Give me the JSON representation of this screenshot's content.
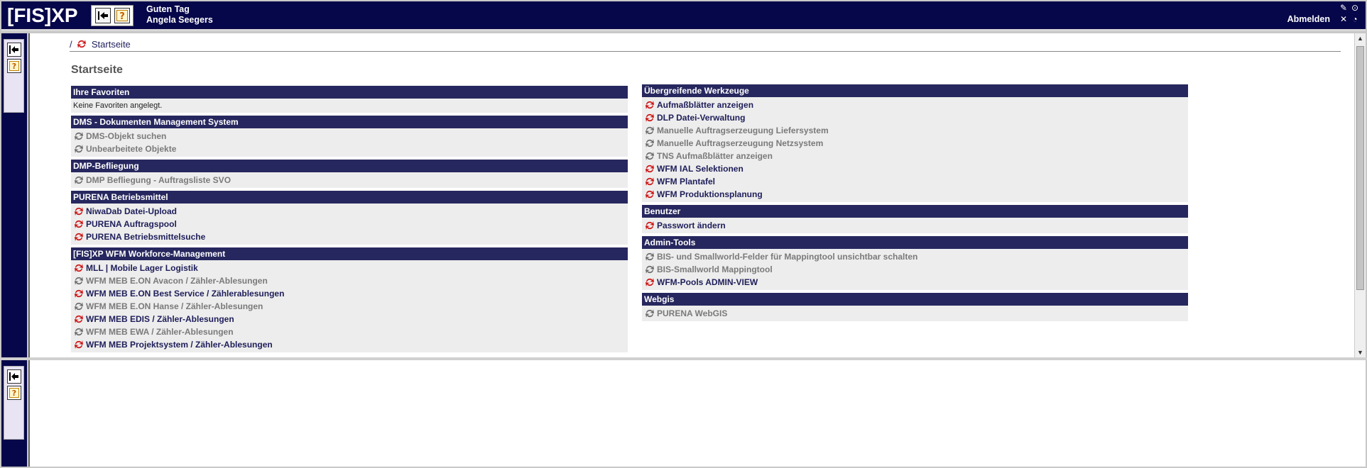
{
  "app": {
    "logo": "[FIS]XP",
    "greeting": "Guten Tag",
    "user": "Angela Seegers",
    "logout": "Abmelden"
  },
  "breadcrumb": {
    "separator": "/",
    "current": "Startseite"
  },
  "page_title": "Startseite",
  "colors": {
    "header_bg": "#06064a",
    "panel_head": "#27275f",
    "active_link": "#1e1e5a",
    "inactive_link": "#7a7a7a",
    "icon_red": "#cc1111"
  },
  "left_column": [
    {
      "title": "Ihre Favoriten",
      "text": "Keine Favoriten angelegt.",
      "items": []
    },
    {
      "title": "DMS - Dokumenten Management System",
      "items": [
        {
          "label": "DMS-Objekt suchen",
          "active": false
        },
        {
          "label": "Unbearbeitete Objekte",
          "active": false
        }
      ]
    },
    {
      "title": "DMP-Befliegung",
      "items": [
        {
          "label": "DMP Befliegung - Auftragsliste SVO",
          "active": false
        }
      ]
    },
    {
      "title": "PURENA Betriebsmittel",
      "items": [
        {
          "label": "NiwaDab Datei-Upload",
          "active": true
        },
        {
          "label": "PURENA Auftragspool",
          "active": true
        },
        {
          "label": "PURENA Betriebsmittelsuche",
          "active": true
        }
      ]
    },
    {
      "title": "[FIS]XP WFM Workforce-Management",
      "items": [
        {
          "label": "MLL | Mobile Lager Logistik",
          "active": true
        },
        {
          "label": "WFM MEB E.ON Avacon / Zähler-Ablesungen",
          "active": false
        },
        {
          "label": "WFM MEB E.ON Best Service / Zählerablesungen",
          "active": true
        },
        {
          "label": "WFM MEB E.ON Hanse / Zähler-Ablesungen",
          "active": false
        },
        {
          "label": "WFM MEB EDIS / Zähler-Ablesungen",
          "active": true
        },
        {
          "label": "WFM MEB EWA / Zähler-Ablesungen",
          "active": false
        },
        {
          "label": "WFM MEB Projektsystem / Zähler-Ablesungen",
          "active": true
        }
      ]
    }
  ],
  "right_column": [
    {
      "title": "Übergreifende Werkzeuge",
      "items": [
        {
          "label": "Aufmaßblätter anzeigen",
          "active": true
        },
        {
          "label": "DLP Datei-Verwaltung",
          "active": true
        },
        {
          "label": "Manuelle Auftragserzeugung Liefersystem",
          "active": false
        },
        {
          "label": "Manuelle Auftragserzeugung Netzsystem",
          "active": false
        },
        {
          "label": "TNS Aufmaßblätter anzeigen",
          "active": false
        },
        {
          "label": "WFM IAL Selektionen",
          "active": true
        },
        {
          "label": "WFM Plantafel",
          "active": true
        },
        {
          "label": "WFM Produktionsplanung",
          "active": true
        }
      ]
    },
    {
      "title": "Benutzer",
      "items": [
        {
          "label": "Passwort ändern",
          "active": true
        }
      ]
    },
    {
      "title": "Admin-Tools",
      "items": [
        {
          "label": "BIS- und Smallworld-Felder für Mappingtool unsichtbar schalten",
          "active": false
        },
        {
          "label": "BIS-Smallworld Mappingtool",
          "active": false
        },
        {
          "label": "WFM-Pools ADMIN-VIEW",
          "active": true
        }
      ]
    },
    {
      "title": "Webgis",
      "items": [
        {
          "label": "PURENA WebGIS",
          "active": false
        }
      ]
    }
  ]
}
